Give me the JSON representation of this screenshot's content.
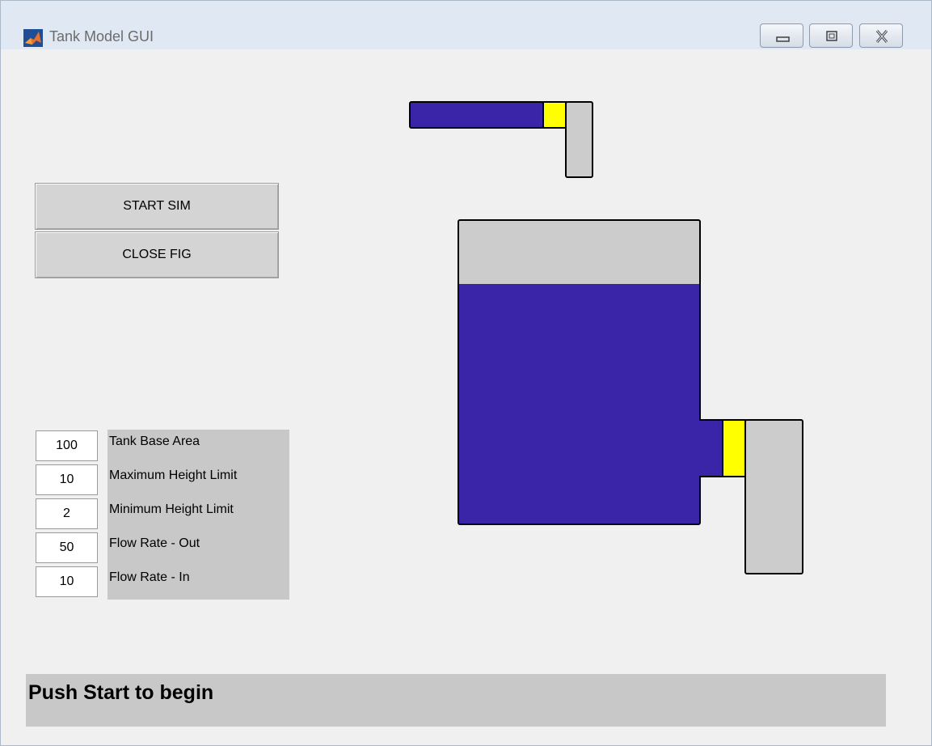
{
  "window": {
    "title": "Tank Model GUI",
    "controls": [
      "minimize-icon",
      "maximize-icon",
      "close-icon"
    ],
    "app_icon": "matlab-logo-icon"
  },
  "buttons": {
    "start": "START SIM",
    "close": "CLOSE FIG"
  },
  "params": [
    {
      "value": "100",
      "label": "Tank Base Area"
    },
    {
      "value": "10",
      "label": "Maximum Height Limit"
    },
    {
      "value": "2",
      "label": "Minimum Height Limit"
    },
    {
      "value": "50",
      "label": "Flow Rate - Out"
    },
    {
      "value": "10",
      "label": "Flow Rate - In"
    }
  ],
  "status": "Push Start to begin",
  "tank": {
    "fill_level_fraction": 0.79,
    "colors": {
      "water": "#3a24a8",
      "empty": "#cccccc",
      "valve": "#ffff00",
      "outline": "#000000",
      "panel": "#c8c8c8"
    }
  }
}
